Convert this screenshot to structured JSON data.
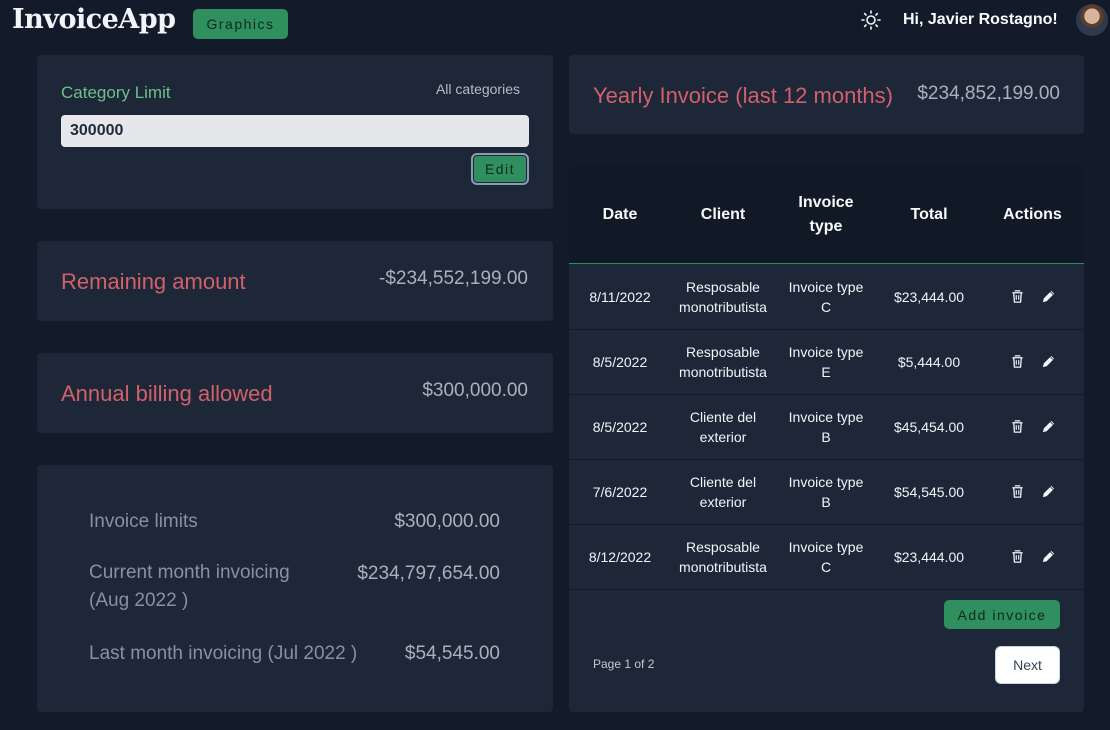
{
  "header": {
    "logo": "InvoiceApp",
    "graphics_label": "Graphics",
    "theme_icon": "sun-icon",
    "greeting": "Hi, Javier Rostagno!"
  },
  "category_limit": {
    "title": "Category Limit",
    "filter_label": "All categories",
    "input_value": "300000",
    "edit_label": "Edit"
  },
  "remaining": {
    "title": "Remaining amount",
    "value": "-$234,552,199.00"
  },
  "annual": {
    "title": "Annual billing allowed",
    "value": "$300,000.00"
  },
  "summary": {
    "rows": [
      {
        "label": "Invoice limits",
        "value": "$300,000.00"
      },
      {
        "label": "Current month invoicing (Aug 2022 )",
        "value": "$234,797,654.00"
      },
      {
        "label": "Last month invoicing (Jul 2022 )",
        "value": "$54,545.00"
      }
    ]
  },
  "yearly": {
    "title": "Yearly Invoice (last 12 months)",
    "value": "$234,852,199.00"
  },
  "table": {
    "headers": [
      "Date",
      "Client",
      "Invoice type",
      "Total",
      "Actions"
    ],
    "rows": [
      {
        "date": "8/11/2022",
        "client": "Resposable monotributista",
        "type": "Invoice type C",
        "total": "$23,444.00"
      },
      {
        "date": "8/5/2022",
        "client": "Resposable monotributista",
        "type": "Invoice type E",
        "total": "$5,444.00"
      },
      {
        "date": "8/5/2022",
        "client": "Cliente del exterior",
        "type": "Invoice type B",
        "total": "$45,454.00"
      },
      {
        "date": "7/6/2022",
        "client": "Cliente del exterior",
        "type": "Invoice type B",
        "total": "$54,545.00"
      },
      {
        "date": "8/12/2022",
        "client": "Resposable monotributista",
        "type": "Invoice type C",
        "total": "$23,444.00"
      }
    ],
    "action_icons": [
      "trash-icon",
      "pencil-icon"
    ],
    "add_label": "Add invoice",
    "page_info": "Page 1 of 2",
    "next_label": "Next"
  },
  "colors": {
    "background": "#131b2a",
    "card": "#1d2738",
    "accent_green": "#2f8f5e",
    "title_red": "#d0616a",
    "title_green": "#6fbf8c"
  }
}
